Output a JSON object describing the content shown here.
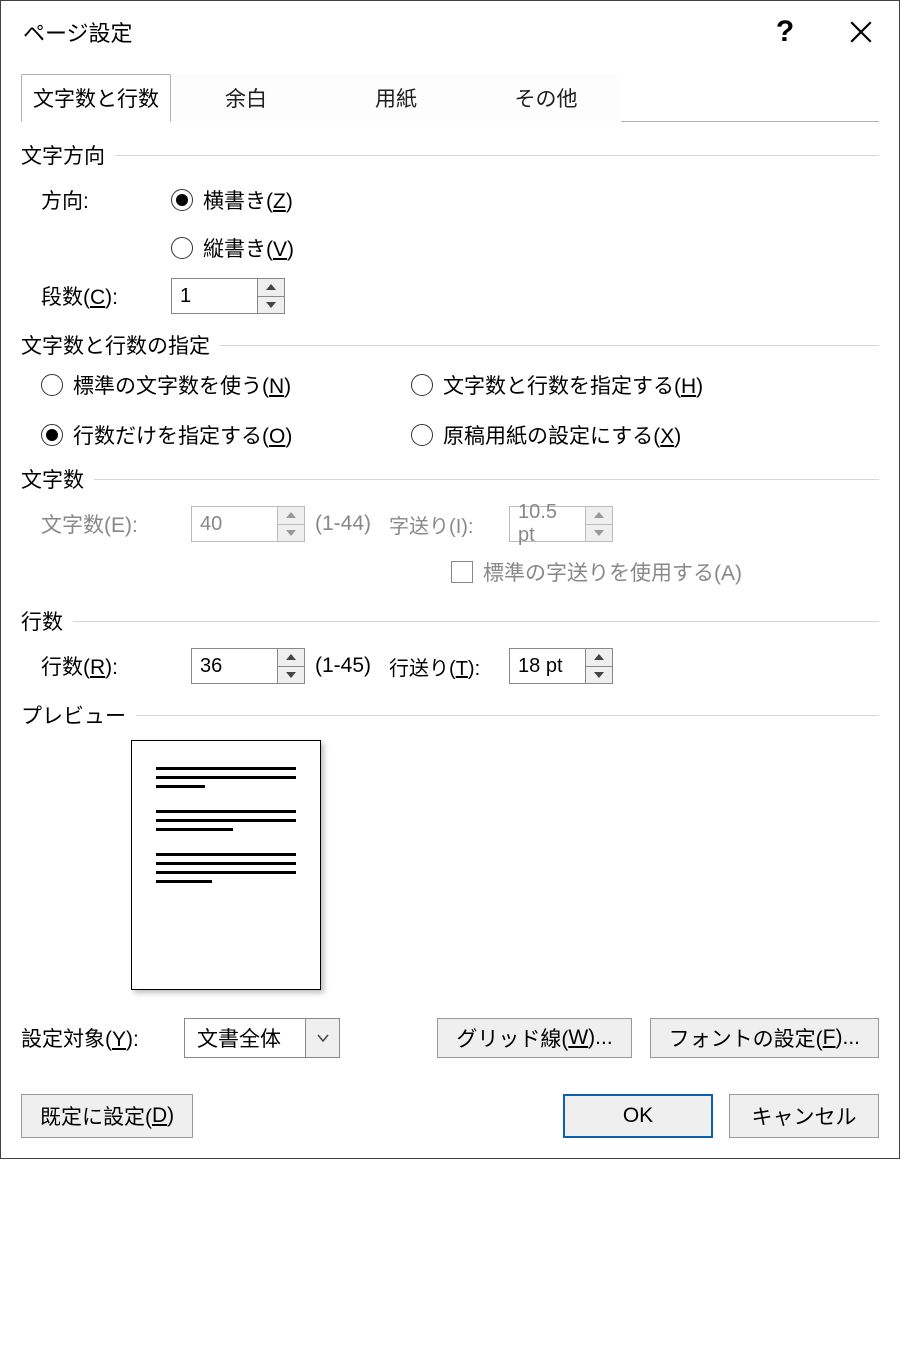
{
  "title": "ページ設定",
  "help": "?",
  "tabs": [
    "文字数と行数",
    "余白",
    "用紙",
    "その他"
  ],
  "active_tab": 0,
  "text_direction": {
    "heading": "文字方向",
    "label": "方向:",
    "horizontal": "横書き(",
    "horizontal_key": "Z",
    "horizontal_suffix": ")",
    "vertical": "縦書き(",
    "vertical_key": "V",
    "vertical_suffix": ")",
    "selected": "horizontal"
  },
  "columns": {
    "label": "段数(",
    "key": "C",
    "suffix": "):",
    "value": "1"
  },
  "grid_spec": {
    "heading": "文字数と行数の指定",
    "opts": {
      "std": {
        "pre": "標準の文字数を使う(",
        "key": "N",
        "suf": ")"
      },
      "both": {
        "pre": "文字数と行数を指定する(",
        "key": "H",
        "suf": ")"
      },
      "lines": {
        "pre": "行数だけを指定する(",
        "key": "O",
        "suf": ")"
      },
      "genkou": {
        "pre": "原稿用紙の設定にする(",
        "key": "X",
        "suf": ")"
      }
    },
    "selected": "lines"
  },
  "chars": {
    "heading": "文字数",
    "count_label": "文字数(E):",
    "count_value": "40",
    "count_range": "(1-44)",
    "pitch_label": "字送り(I):",
    "pitch_value": "10.5 pt",
    "std_pitch_pre": "標準の字送りを使用する(A)"
  },
  "lines": {
    "heading": "行数",
    "count_label_pre": "行数(",
    "count_key": "R",
    "count_label_suf": "):",
    "count_value": "36",
    "count_range": "(1-45)",
    "pitch_label_pre": "行送り(",
    "pitch_key": "T",
    "pitch_label_suf": "):",
    "pitch_value": "18 pt"
  },
  "preview_heading": "プレビュー",
  "apply_to": {
    "label_pre": "設定対象(",
    "key": "Y",
    "label_suf": "):",
    "value": "文書全体"
  },
  "grid_btn": {
    "pre": "グリッド線(",
    "key": "W",
    "suf": ")..."
  },
  "font_btn": {
    "pre": "フォントの設定(",
    "key": "F",
    "suf": ")..."
  },
  "default_btn": {
    "pre": "既定に設定(",
    "key": "D",
    "suf": ")"
  },
  "ok": "OK",
  "cancel": "キャンセル"
}
